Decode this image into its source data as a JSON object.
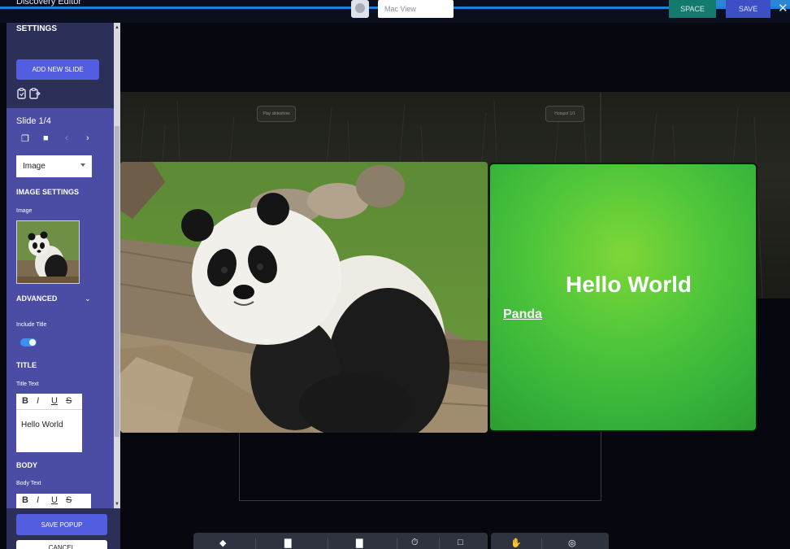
{
  "topbar": {
    "app_title": "Discovery Editor",
    "view_select": "Mac View",
    "space_label": "SPACE",
    "save_label": "SAVE",
    "close_glyph": "✕"
  },
  "sidebar": {
    "settings_heading": "SETTINGS",
    "add_slide_label": "ADD NEW SLIDE",
    "slide_counter": "Slide 1/4",
    "type_select_value": "Image",
    "image_settings_heading": "IMAGE SETTINGS",
    "image_label": "Image",
    "advanced_heading": "ADVANCED",
    "advanced_chevron": "⌄",
    "include_title_label": "Include Title",
    "include_title_enabled": true,
    "title_heading": "TITLE",
    "title_text_label": "Title Text",
    "title_text_value": "Hello World",
    "body_heading": "BODY",
    "body_text_label": "Body Text",
    "format_buttons": [
      "B",
      "I",
      "U",
      "S"
    ],
    "save_popup_label": "SAVE POPUP",
    "cancel_label": "CANCEL"
  },
  "canvas": {
    "band_tag_1": "Play slideshow",
    "band_tag_2": "Hotspot 1/1",
    "card_title": "Hello World",
    "card_link": "Panda"
  },
  "icons": {
    "copy": "copy-icon",
    "paste": "paste-icon",
    "duplicate": "duplicate-icon",
    "delete": "trash-icon",
    "prev": "chevron-left-icon",
    "next": "chevron-right-icon"
  },
  "colors": {
    "sidebar": "#4a4da3",
    "sidebar_dark": "#2c2f57",
    "primary_button": "#525de0",
    "space_button": "#137a6d",
    "save_button": "#3e4ec6",
    "card_green": "#4fc63a"
  }
}
